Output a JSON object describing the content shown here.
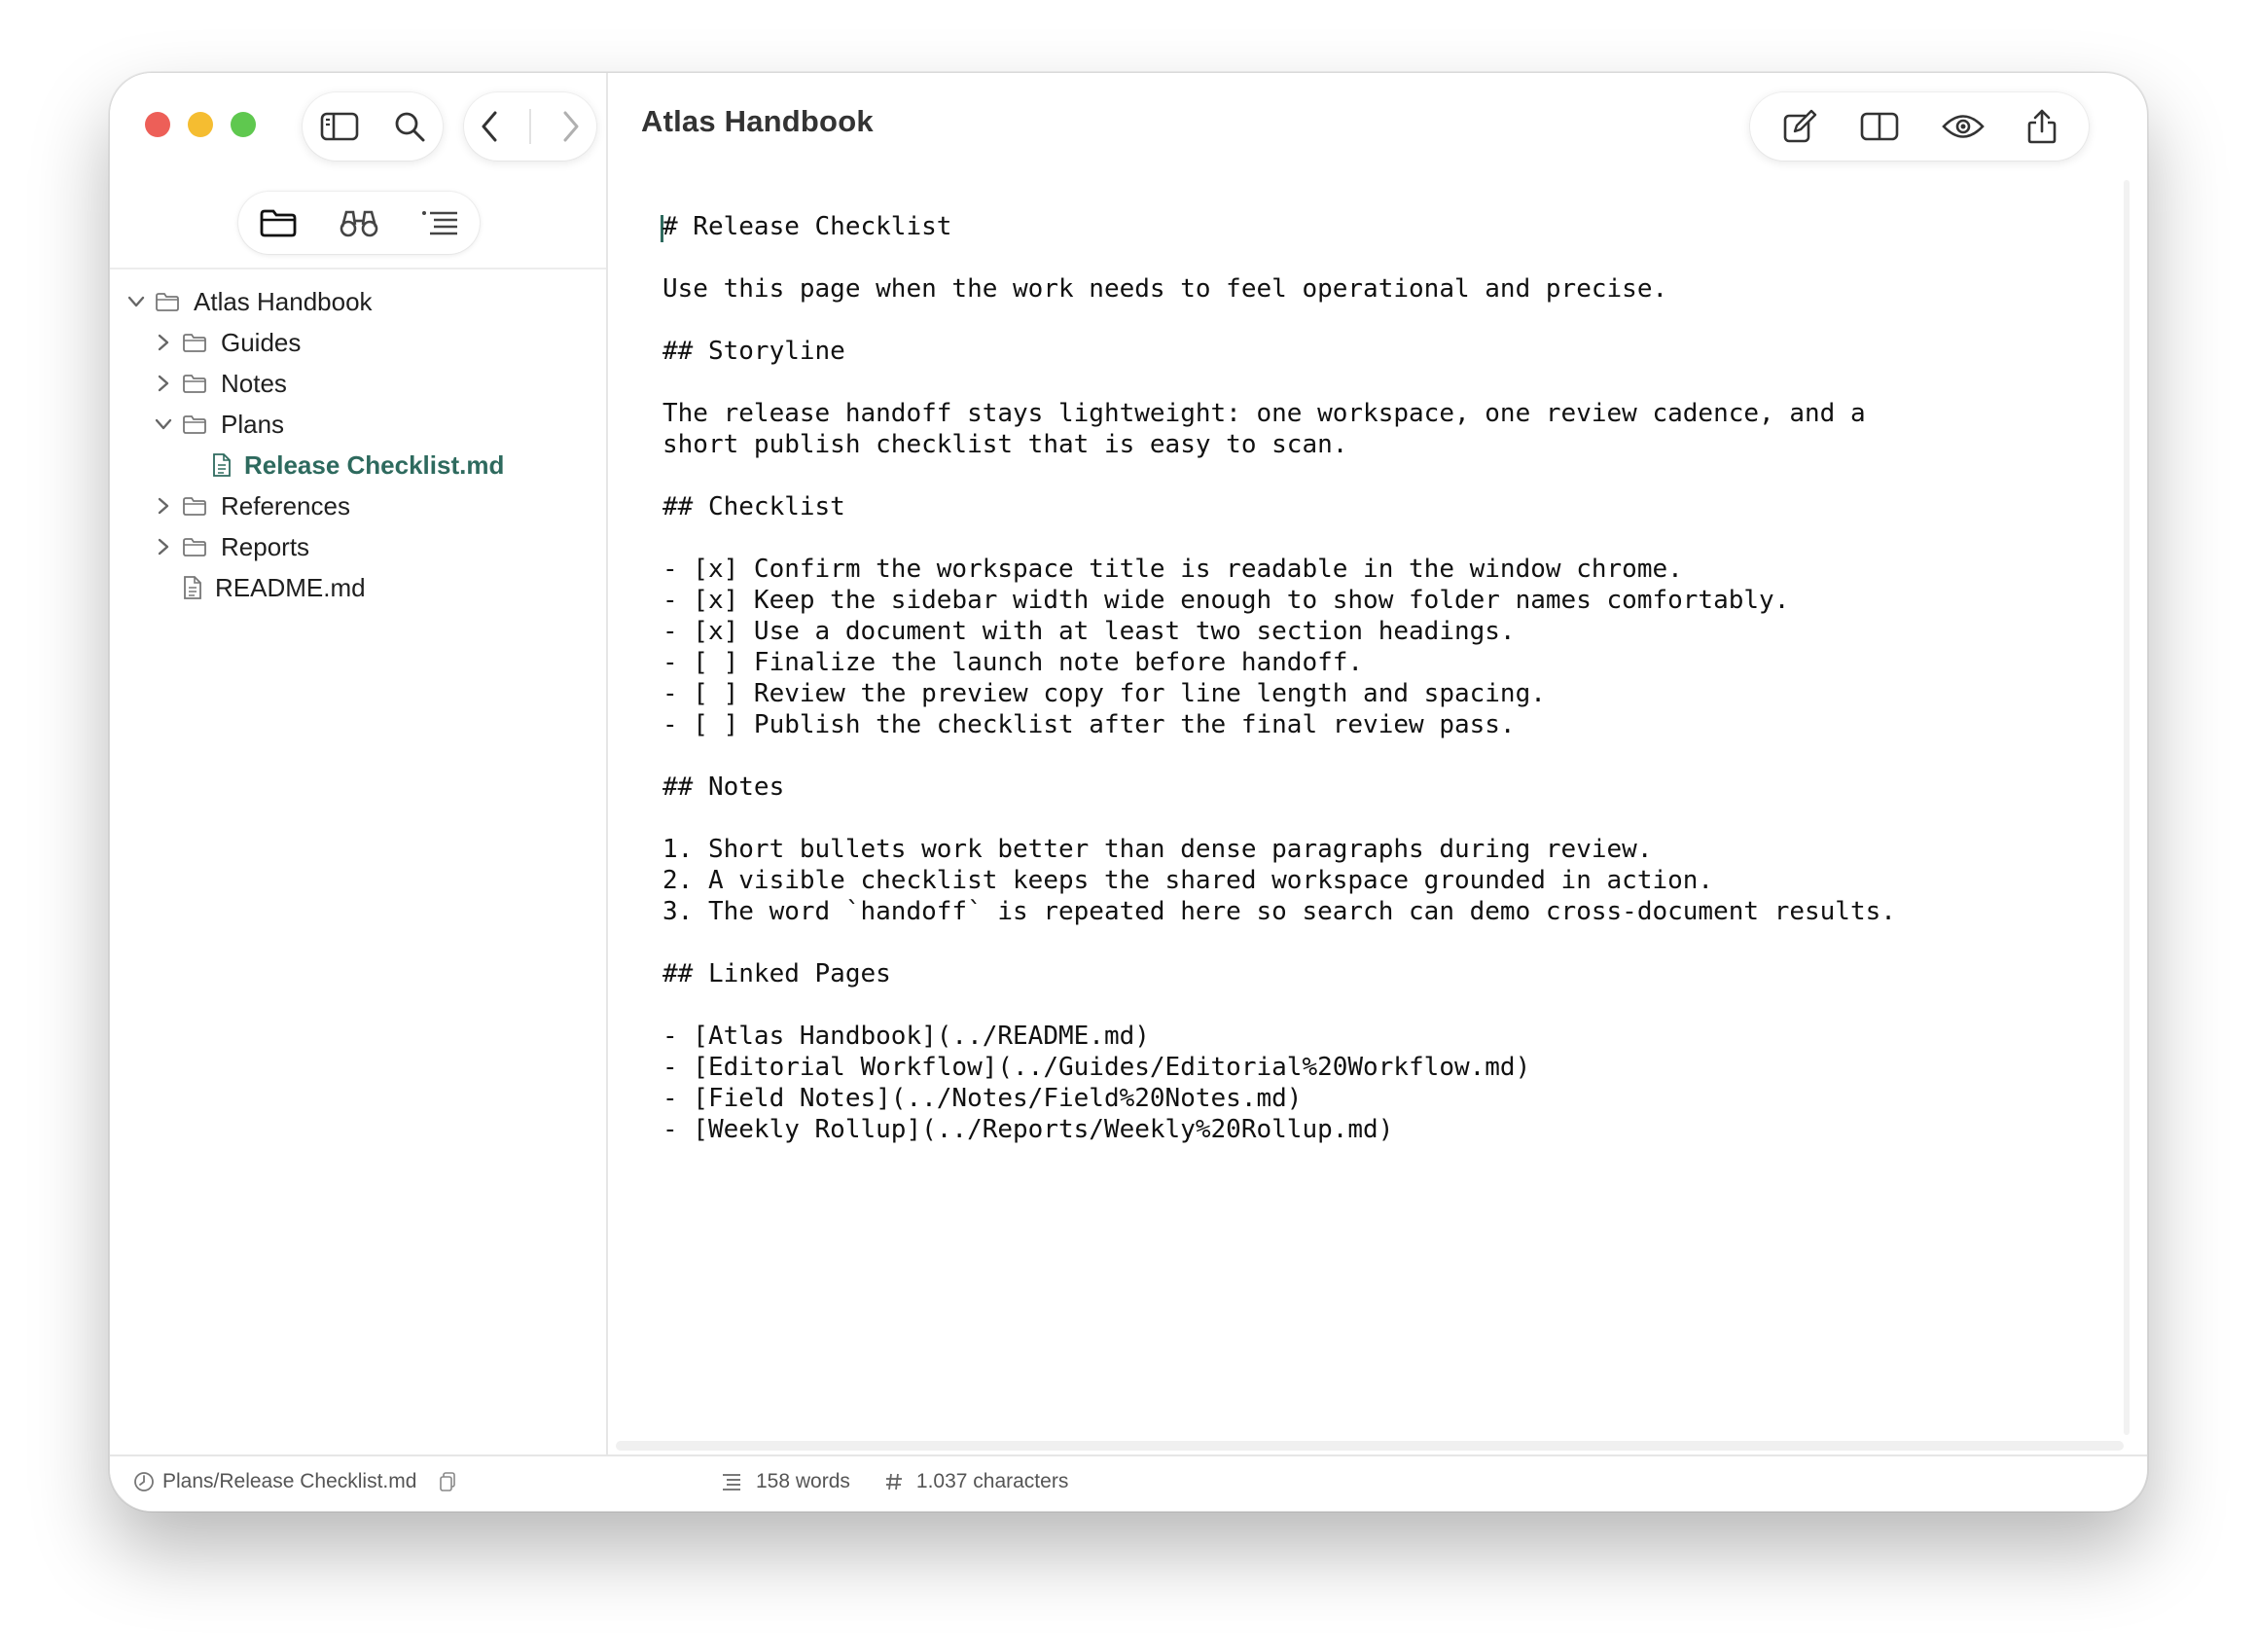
{
  "window": {
    "title": "Atlas Handbook"
  },
  "sidebar": {
    "tabs": [
      "files-tab",
      "search-tab",
      "outline-tab"
    ],
    "tree": [
      {
        "label": "Atlas Handbook",
        "type": "folder",
        "level": 0,
        "expanded": true
      },
      {
        "label": "Guides",
        "type": "folder",
        "level": 1,
        "expanded": false
      },
      {
        "label": "Notes",
        "type": "folder",
        "level": 1,
        "expanded": false
      },
      {
        "label": "Plans",
        "type": "folder",
        "level": 1,
        "expanded": true
      },
      {
        "label": "Release Checklist.md",
        "type": "file",
        "level": 2,
        "active": true
      },
      {
        "label": "References",
        "type": "folder",
        "level": 1,
        "expanded": false
      },
      {
        "label": "Reports",
        "type": "folder",
        "level": 1,
        "expanded": false
      },
      {
        "label": "README.md",
        "type": "file",
        "level": 1,
        "active": false
      }
    ]
  },
  "editor": {
    "lines": [
      "# Release Checklist",
      "",
      "Use this page when the work needs to feel operational and precise.",
      "",
      "## Storyline",
      "",
      "The release handoff stays lightweight: one workspace, one review cadence, and a",
      "short publish checklist that is easy to scan.",
      "",
      "## Checklist",
      "",
      "- [x] Confirm the workspace title is readable in the window chrome.",
      "- [x] Keep the sidebar width wide enough to show folder names comfortably.",
      "- [x] Use a document with at least two section headings.",
      "- [ ] Finalize the launch note before handoff.",
      "- [ ] Review the preview copy for line length and spacing.",
      "- [ ] Publish the checklist after the final review pass.",
      "",
      "## Notes",
      "",
      "1. Short bullets work better than dense paragraphs during review.",
      "2. A visible checklist keeps the shared workspace grounded in action.",
      "3. The word `handoff` is repeated here so search can demo cross-document results.",
      "",
      "## Linked Pages",
      "",
      "- [Atlas Handbook](../README.md)",
      "- [Editorial Workflow](../Guides/Editorial%20Workflow.md)",
      "- [Field Notes](../Notes/Field%20Notes.md)",
      "- [Weekly Rollup](../Reports/Weekly%20Rollup.md)"
    ]
  },
  "status": {
    "path": "Plans/Release Checklist.md",
    "words": "158 words",
    "characters": "1.037 characters"
  },
  "colors": {
    "accent": "#2e6a5e",
    "traffic_red": "#ed5f58",
    "traffic_yellow": "#f5bd31",
    "traffic_green": "#5fc84f"
  }
}
